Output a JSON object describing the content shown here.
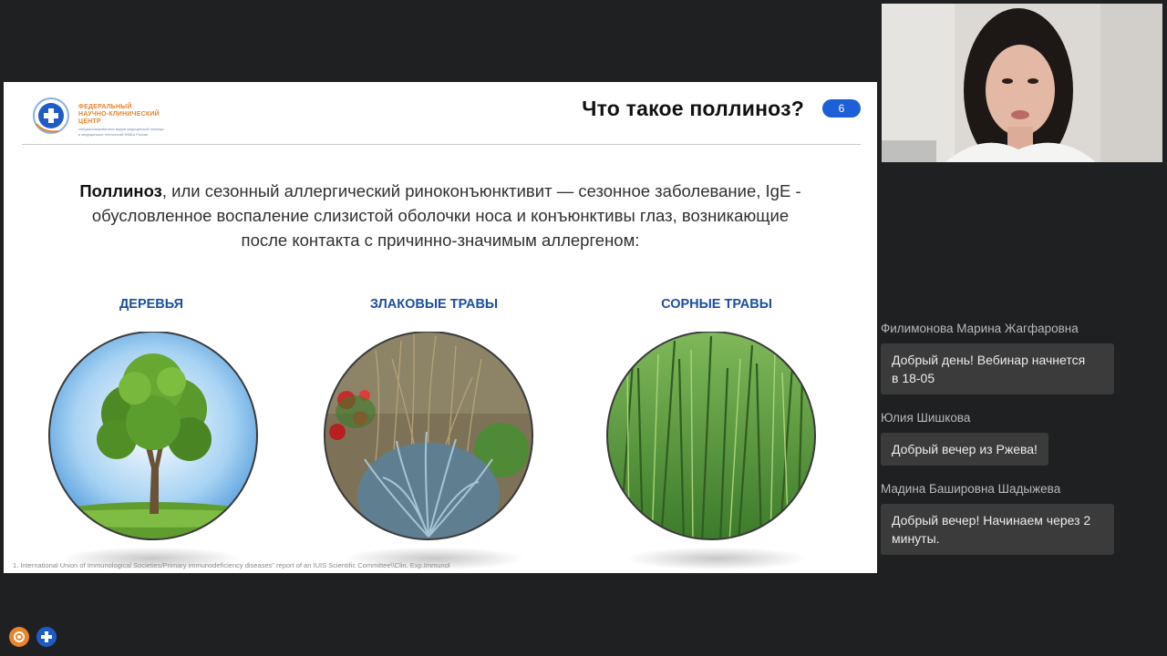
{
  "slide": {
    "logo": {
      "line1": "ФЕДЕРАЛЬНЫЙ",
      "line2": "НАУЧНО-КЛИНИЧЕСКИЙ ЦЕНТР",
      "line3": "специализированных видов медицинской помощи",
      "line4": "и медицинских технологий ФМБА России"
    },
    "title": "Что такое поллиноз?",
    "page_number": "6",
    "definition_term": "Поллиноз",
    "definition_rest_1": ", или сезонный аллергический риноконъюнктивит — сезонное заболевание, IgE -",
    "definition_rest_2": "обусловленное воспаление слизистой оболочки носа и конъюнктивы глаз, возникающие",
    "definition_rest_3": "после контакта с причинно-значимым аллергеном:",
    "categories": [
      {
        "label": "ДЕРЕВЬЯ",
        "image": "tree"
      },
      {
        "label": "ЗЛАКОВЫЕ ТРАВЫ",
        "image": "cereal-grass"
      },
      {
        "label": "СОРНЫЕ ТРАВЫ",
        "image": "weed-grass"
      }
    ],
    "footnote": "1. International Union of Immunological Societies/Primary immunodeficiency diseases\" report of an IUIS Scientific Committee\\\\Clin. Exp.Immunol"
  },
  "chat": {
    "messages": [
      {
        "author": "Филимонова Марина Жагфаровна",
        "text_1": "Добрый день! Вебинар начнется",
        "text_2": "в 18-05"
      },
      {
        "author": "Юлия Шишкова",
        "text_1": "Добрый вечер из Ржева!",
        "text_2": ""
      },
      {
        "author": "Мадина Башировна Шадыжева",
        "text_1": "Добрый вечер! Начинаем через 2",
        "text_2": "минуты."
      }
    ]
  },
  "colors": {
    "background": "#1f2021",
    "accent_blue": "#1c5fd6",
    "category_blue": "#1d4ea3",
    "bubble": "#3b3b3b",
    "logo_orange": "#e2852c"
  },
  "icons": [
    "settings-icon",
    "app-logo-icon"
  ]
}
